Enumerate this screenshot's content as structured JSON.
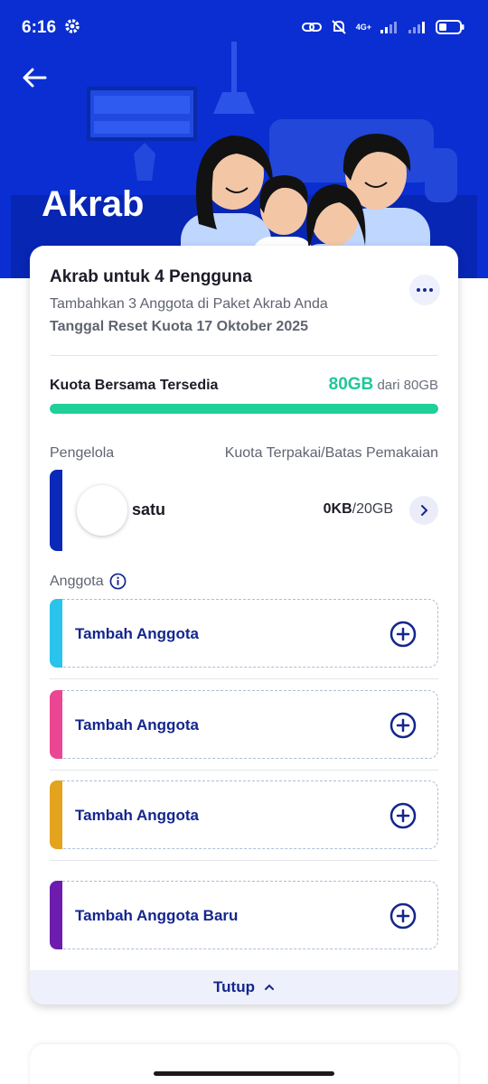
{
  "status_bar": {
    "time": "6:16",
    "network_label": "4G+",
    "icons": [
      "settings-gear-icon",
      "link-icon",
      "muted-bell-icon",
      "signal-icon",
      "signal-icon",
      "battery-icon"
    ]
  },
  "header": {
    "title": "Akrab",
    "back_icon": "arrow-left-icon",
    "background_color": "#0a2ed1"
  },
  "card": {
    "title": "Akrab untuk 4 Pengguna",
    "subtitle": "Tambahkan 3 Anggota di Paket Akrab Anda",
    "reset_text": "Tanggal Reset Kuota 17 Oktober 2025",
    "more_icon": "more-horizontal-icon",
    "quota": {
      "label": "Kuota Bersama Tersedia",
      "available": "80GB",
      "total_text": "dari 80GB",
      "fill_fraction": 1.0,
      "bar_color": "#1fd09a"
    },
    "manager_section_label": "Pengelola",
    "usage_header_label": "Kuota Terpakai/Batas Pemakaian",
    "manager": {
      "name": "satu",
      "used": "0KB",
      "limit": "/20GB",
      "accent_color": "#0b29b8"
    },
    "members_label": "Anggota",
    "members": [
      {
        "label": "Tambah Anggota",
        "accent_color": "#29c3ec"
      },
      {
        "label": "Tambah Anggota",
        "accent_color": "#ec4593"
      },
      {
        "label": "Tambah Anggota",
        "accent_color": "#e3a31d"
      },
      {
        "label": "Tambah Anggota Baru",
        "accent_color": "#6d1cae"
      }
    ],
    "close_label": "Tutup"
  }
}
